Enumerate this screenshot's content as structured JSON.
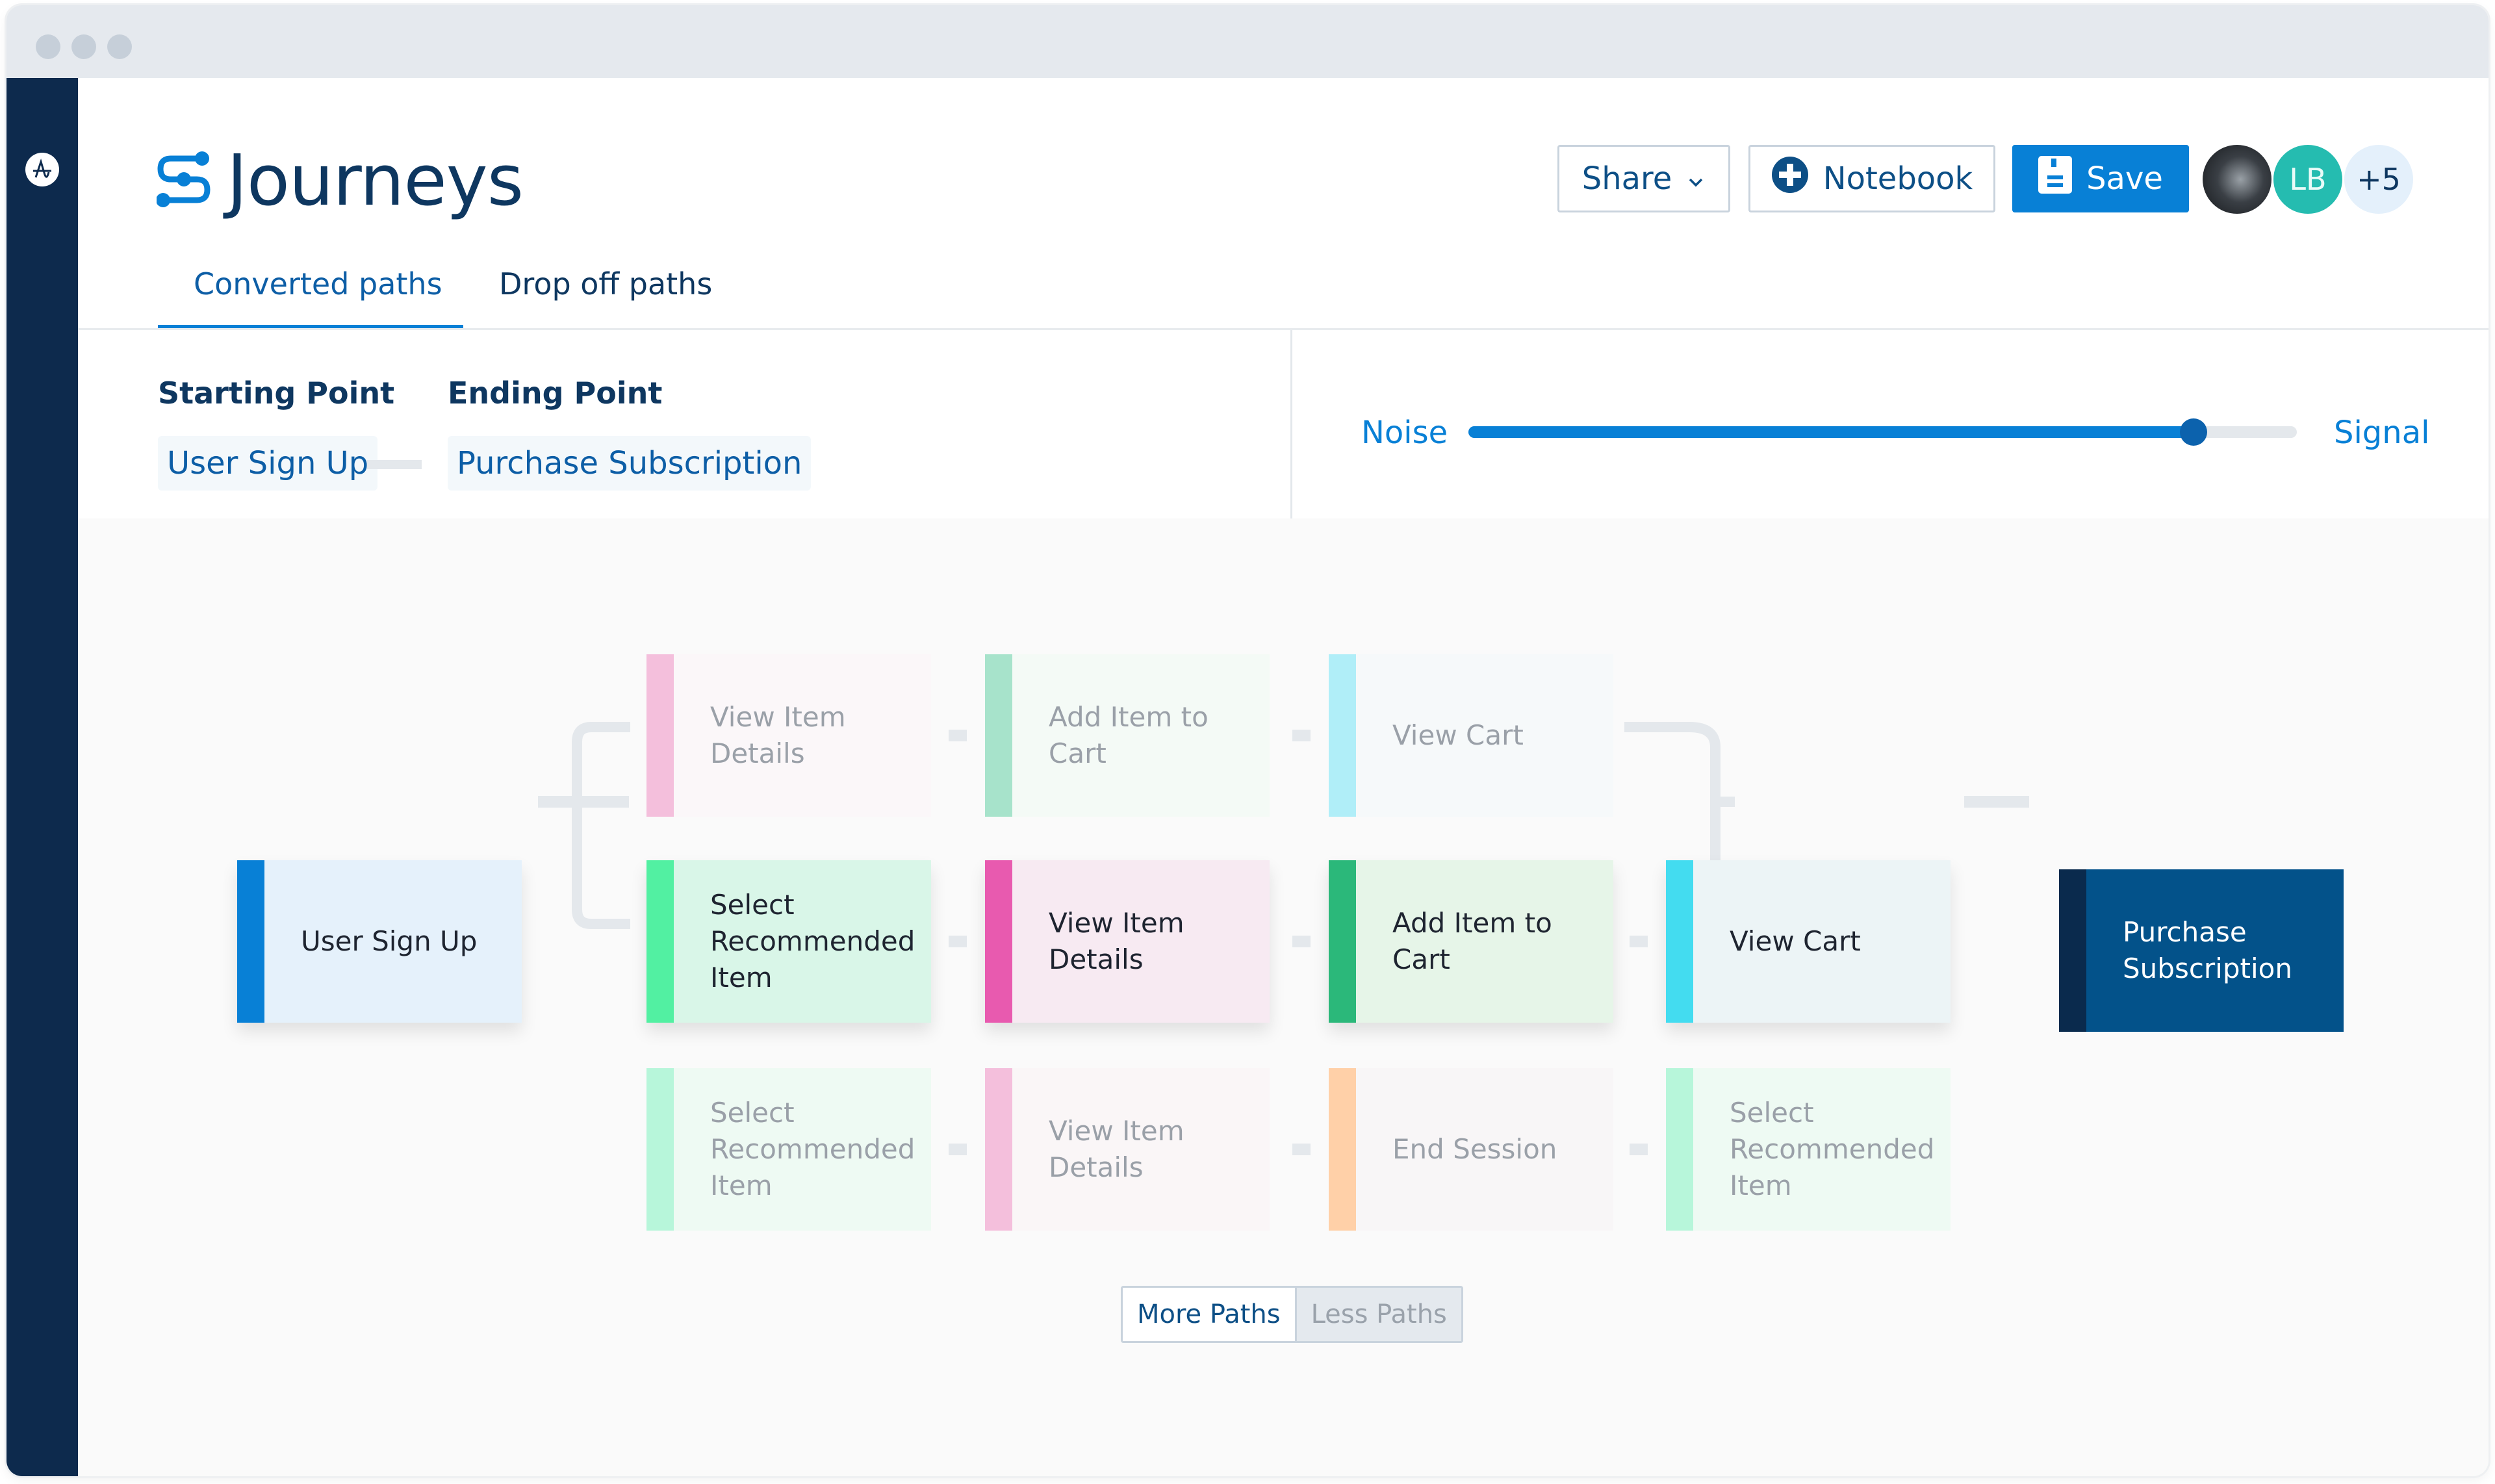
{
  "window": {
    "controls": [
      "close",
      "minimize",
      "maximize"
    ]
  },
  "sidebar": {
    "logo_icon": "amplitude-logo-icon"
  },
  "header": {
    "title": "Journeys",
    "title_icon": "journeys-path-icon",
    "share_label": "Share",
    "notebook_label": "Notebook",
    "save_label": "Save",
    "avatars": [
      {
        "type": "photo",
        "label": ""
      },
      {
        "type": "initials",
        "label": "LB",
        "color": "#25bcb0"
      },
      {
        "type": "overflow",
        "label": "+5"
      }
    ]
  },
  "tabs": [
    {
      "label": "Converted paths",
      "active": true
    },
    {
      "label": "Drop off paths",
      "active": false
    }
  ],
  "config": {
    "starting_label": "Starting Point",
    "ending_label": "Ending Point",
    "starting_value": "User Sign Up",
    "ending_value": "Purchase Subscription",
    "slider": {
      "left_label": "Noise",
      "right_label": "Signal",
      "value_percent": 87.5
    }
  },
  "paths": {
    "start": {
      "label": "User Sign Up",
      "color": "#0880d6",
      "bg": "#e5f1fb"
    },
    "end": {
      "label": "Purchase Subscription",
      "color": "#0a2a4d",
      "bg": "#03528a"
    },
    "rows": [
      {
        "active": false,
        "steps": [
          {
            "label": "View Item Details",
            "color": "#f4bfdc",
            "bg": "#fbf7f9"
          },
          {
            "label": "Add Item to Cart",
            "color": "#a7e3cb",
            "bg": "#f4faf6"
          },
          {
            "label": "View Cart",
            "color": "#b0eef8",
            "bg": "#f6f9fa"
          }
        ]
      },
      {
        "active": true,
        "steps": [
          {
            "label": "Select Recommended Item",
            "color": "#52f0a2",
            "bg": "#d9f6e8"
          },
          {
            "label": "View Item Details",
            "color": "#e85aaf",
            "bg": "#f7eaf2"
          },
          {
            "label": "Add Item to Cart",
            "color": "#2bb87a",
            "bg": "#e6f5e8"
          },
          {
            "label": "View Cart",
            "color": "#43dcf0",
            "bg": "#ecf4f6"
          }
        ]
      },
      {
        "active": false,
        "steps": [
          {
            "label": "Select Recommended Item",
            "color": "#b7f6da",
            "bg": "#eefaf3"
          },
          {
            "label": "View Item Details",
            "color": "#f4bfdc",
            "bg": "#faf6f7"
          },
          {
            "label": "End Session",
            "color": "#ffd0a8",
            "bg": "#f8f6f7"
          },
          {
            "label": "Select Recommended Item",
            "color": "#b7f6da",
            "bg": "#eefaf3"
          }
        ]
      }
    ]
  },
  "pager": {
    "more_label": "More Paths",
    "less_label": "Less Paths"
  }
}
